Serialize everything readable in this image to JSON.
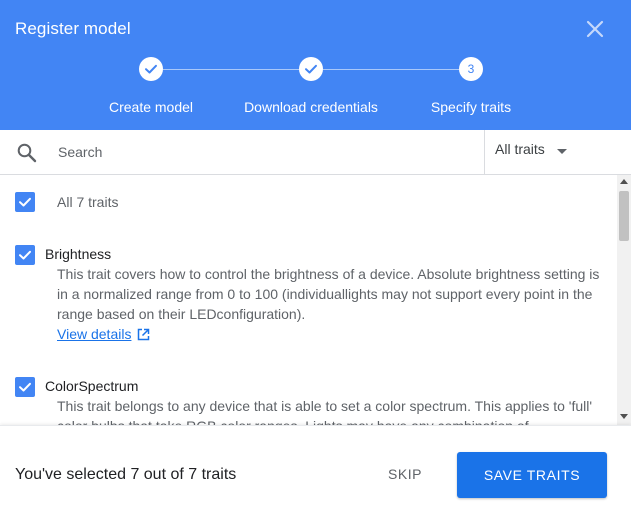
{
  "dialog": {
    "title": "Register model",
    "close_icon": "close-icon"
  },
  "stepper": {
    "steps": [
      {
        "label": "Create model",
        "state": "complete",
        "icon": "check-icon"
      },
      {
        "label": "Download credentials",
        "state": "complete",
        "icon": "check-icon"
      },
      {
        "label": "Specify traits",
        "state": "active",
        "number": "3"
      }
    ]
  },
  "search": {
    "placeholder": "Search",
    "value": "",
    "icon": "search-icon"
  },
  "filter": {
    "selected": "All traits",
    "icon": "dropdown-arrow-icon"
  },
  "traits": {
    "all_label": "All 7 traits",
    "all_checked": true,
    "items": [
      {
        "name": "Brightness",
        "checked": true,
        "description_lines": [
          "This trait covers how to control the brightness of a device. Absolute brightness setting is",
          "in a normalized range from 0 to 100 (individuallights may not support every point in the",
          "range based on their LEDconfiguration)."
        ],
        "link": "View details",
        "link_icon": "open-in-new-icon"
      },
      {
        "name": "ColorSpectrum",
        "checked": true,
        "description_lines": [
          "This trait belongs to any device that is able to set a color spectrum. This applies to 'full'",
          "color bulbs that take RGB color ranges. Lights may have any combination of"
        ]
      }
    ]
  },
  "footer": {
    "status": "You've selected 7 out of 7 traits",
    "skip_label": "SKIP",
    "save_label": "SAVE TRAITS"
  },
  "colors": {
    "header_bg": "#4285f4",
    "primary_button": "#1a73e8",
    "link": "#1a73e8"
  }
}
